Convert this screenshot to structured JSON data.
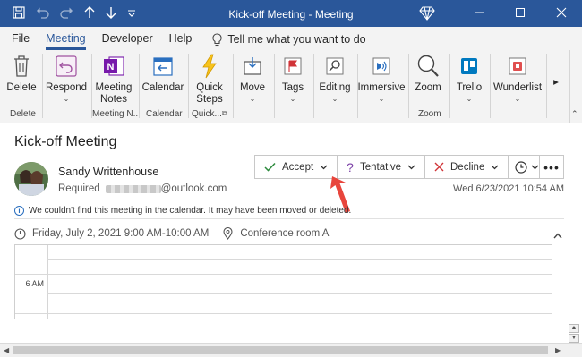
{
  "window": {
    "title": "Kick-off Meeting  -  Meeting"
  },
  "tabs": [
    "File",
    "Meeting",
    "Developer",
    "Help"
  ],
  "tell_me": "Tell me what you want to do",
  "ribbon": {
    "delete": "Delete",
    "respond": "Respond",
    "meeting_notes_1": "Meeting",
    "meeting_notes_2": "Notes",
    "calendar": "Calendar",
    "quick_steps_1": "Quick",
    "quick_steps_2": "Steps",
    "move": "Move",
    "tags": "Tags",
    "editing": "Editing",
    "immersive": "Immersive",
    "zoom": "Zoom",
    "trello": "Trello",
    "wunderlist": "Wunderlist",
    "groups": {
      "delete": "Delete",
      "meeting_notes": "Meeting N...",
      "calendar": "Calendar",
      "quick_steps": "Quick...",
      "zoom": "Zoom"
    }
  },
  "message": {
    "subject": "Kick-off Meeting",
    "sender": "Sandy Writtenhouse",
    "required_label": "Required",
    "email_suffix": "@outlook.com",
    "date": "Wed 6/23/2021 10:54 AM",
    "notice": "We couldn't find this meeting in the calendar. It may have been moved or deleted.",
    "when": "Friday, July 2, 2021 9:00 AM-10:00 AM",
    "location": "Conference room A"
  },
  "actions": {
    "accept": "Accept",
    "tentative": "Tentative",
    "decline": "Decline"
  },
  "calendar": {
    "hour_label": "6 AM"
  },
  "colors": {
    "accent": "#2a579a",
    "accept_check": "#2e8b3e",
    "tentative_mark": "#7a3fa6",
    "decline_x": "#d13438",
    "annotation_arrow": "#e8453c"
  },
  "icons": {
    "title_bar": [
      "save-icon",
      "undo-icon",
      "redo-icon",
      "up-arrow-icon",
      "down-arrow-icon",
      "customize-icon",
      "diamond-icon",
      "minimize-icon",
      "maximize-icon",
      "close-icon"
    ],
    "info": "info-icon",
    "clock": "clock-icon",
    "location": "location-pin-icon"
  }
}
